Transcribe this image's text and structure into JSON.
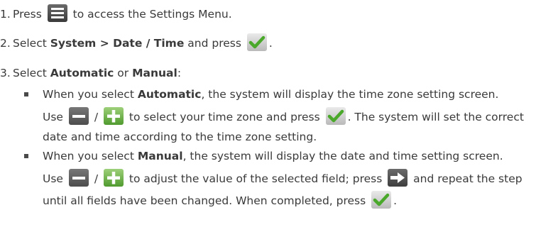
{
  "steps": [
    {
      "num": "1.",
      "pre": "Press ",
      "post": " to access the Settings Menu."
    },
    {
      "num": "2.",
      "pre": "Select ",
      "bold1": "System > Date / Time",
      "mid": " and press ",
      "post": "."
    },
    {
      "num": "3.",
      "pre": "Select ",
      "bold1": "Automatic",
      "mid": " or ",
      "bold2": "Manual",
      "post": ":"
    }
  ],
  "bullets": [
    {
      "line1_pre": "When you select ",
      "line1_bold": "Automatic",
      "line1_post": ", the system will display the time zone setting screen.",
      "line2_pre": "Use ",
      "line2_sep": " / ",
      "line2_mid": " to select your time zone and press ",
      "line2_post": ". The system will set the correct",
      "line3": "date and time according to the time zone setting."
    },
    {
      "line1_pre": "When you select ",
      "line1_bold": "Manual",
      "line1_post": ", the system will display the date and time setting screen.",
      "line2_pre": "Use ",
      "line2_sep": " / ",
      "line2_mid": " to adjust the value of the selected field; press ",
      "line2_post": " and repeat the step",
      "line3_pre": "until all fields have been changed. When completed, press ",
      "line3_post": "."
    }
  ],
  "icons": {
    "menu": "menu-icon",
    "check": "checkmark-icon",
    "minus": "minus-icon",
    "plus": "plus-icon",
    "arrow": "right-arrow-icon"
  }
}
